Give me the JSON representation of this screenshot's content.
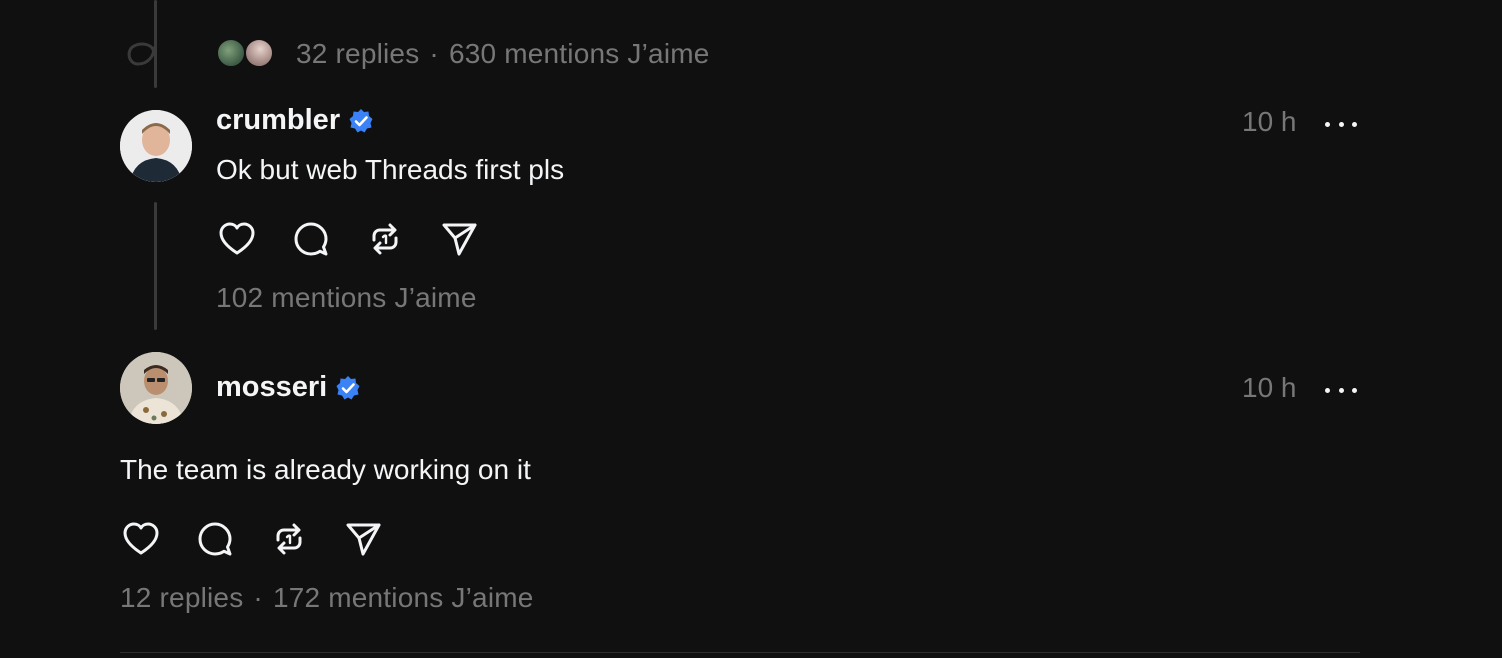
{
  "colors": {
    "background": "#101010",
    "text_primary": "#f3f5f7",
    "text_secondary": "#777777",
    "verified_badge": "#0095f6",
    "thread_line": "#3a3a3a"
  },
  "top_post": {
    "replies": "32 replies",
    "separator": "·",
    "likes": "630 mentions J’aime"
  },
  "posts": [
    {
      "username": "crumbler",
      "verified": true,
      "time": "10 h",
      "text": "Ok but web Threads first pls",
      "likes": "102 mentions J’aime",
      "avatar": "avatar-crumbler"
    },
    {
      "username": "mosseri",
      "verified": true,
      "time": "10 h",
      "text": "The team is already working on it",
      "replies": "12 replies",
      "separator": "·",
      "likes": "172 mentions J’aime",
      "avatar": "avatar-mosseri"
    }
  ],
  "icons": {
    "like": "heart-icon",
    "comment": "comment-icon",
    "repost": "repost-icon",
    "share": "send-icon",
    "more": "more-icon",
    "verified": "verified-badge-icon"
  }
}
